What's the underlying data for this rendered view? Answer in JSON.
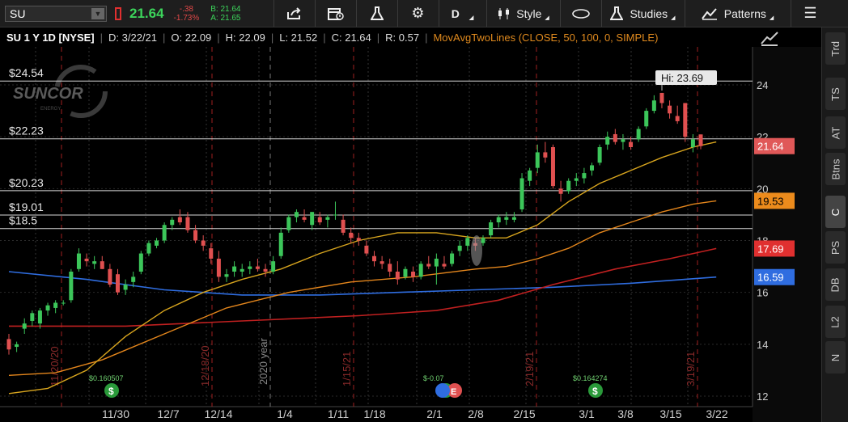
{
  "toolbar": {
    "symbol": "SU",
    "last": "21.64",
    "change": "-.38",
    "change_pct": "-1.73%",
    "bid": "B: 21.64",
    "ask": "A: 21.65",
    "period": "D",
    "style_label": "Style",
    "studies_label": "Studies",
    "patterns_label": "Patterns"
  },
  "header": {
    "title": "SU 1 Y 1D [NYSE]",
    "date": "D: 3/22/21",
    "open": "O: 22.09",
    "high": "H: 22.09",
    "low": "L: 21.52",
    "close": "C: 21.64",
    "range": "R: 0.57",
    "study": "MovAvgTwoLines (CLOSE, 50, 100, 0, SIMPLE)"
  },
  "sidebar_tabs": [
    "Trd",
    "TS",
    "AT",
    "Btns",
    "C",
    "PS",
    "DB",
    "L2",
    "N"
  ],
  "chart_data": {
    "type": "candlestick",
    "symbol": "SU",
    "price_axis": {
      "min": 12,
      "max": 25,
      "ticks": [
        12,
        14,
        16,
        18,
        20,
        22,
        24
      ]
    },
    "x_ticks": [
      "11/30",
      "12/7",
      "12/14",
      "1/4",
      "1/11",
      "1/18",
      "2/1",
      "2/8",
      "2/15",
      "3/1",
      "3/8",
      "3/15",
      "3/22"
    ],
    "levels": [
      {
        "label": "$24.54",
        "value": 24.15
      },
      {
        "label": "$22.23",
        "value": 21.92
      },
      {
        "label": "$20.23",
        "value": 19.92
      },
      {
        "label": "$19.01",
        "value": 18.98
      },
      {
        "label": "$18.5",
        "value": 18.46
      }
    ],
    "price_badges": [
      {
        "label": "21.64",
        "value": 21.64,
        "color": "#e05858"
      },
      {
        "label": "19.53",
        "value": 19.53,
        "color": "#ec8b1c"
      },
      {
        "label": "17.69",
        "value": 17.69,
        "color": "#e03030"
      },
      {
        "label": "16.59",
        "value": 16.59,
        "color": "#2f6de0"
      }
    ],
    "hi_label": "Hi: 23.69",
    "event_lines": [
      "11/20/20",
      "12/18/20",
      "2020 year",
      "1/15/21",
      "2/19/21",
      "3/19/21"
    ],
    "dividends": [
      {
        "label": "$0.160507"
      },
      {
        "label": "$-0.07"
      },
      {
        "label": "$0.164274"
      }
    ],
    "candles": [
      [
        14.2,
        14.4,
        13.6,
        13.8
      ],
      [
        13.9,
        14.1,
        13.7,
        14.0
      ],
      [
        14.6,
        15.0,
        14.4,
        14.8
      ],
      [
        14.9,
        15.3,
        14.7,
        15.2
      ],
      [
        14.8,
        15.4,
        14.6,
        15.3
      ],
      [
        15.3,
        15.6,
        15.1,
        15.5
      ],
      [
        15.4,
        15.7,
        15.2,
        15.6
      ],
      [
        15.6,
        15.7,
        15.5,
        15.6
      ],
      [
        15.7,
        16.9,
        15.6,
        16.8
      ],
      [
        16.9,
        17.7,
        16.8,
        17.5
      ],
      [
        17.3,
        17.5,
        17.0,
        17.2
      ],
      [
        17.1,
        17.4,
        16.9,
        17.2
      ],
      [
        17.2,
        17.4,
        16.9,
        16.9
      ],
      [
        16.9,
        17.1,
        16.2,
        16.3
      ],
      [
        16.7,
        16.9,
        15.9,
        16.0
      ],
      [
        16.1,
        16.5,
        15.9,
        16.3
      ],
      [
        16.4,
        16.8,
        16.2,
        16.6
      ],
      [
        16.8,
        17.6,
        16.7,
        17.5
      ],
      [
        17.5,
        18.0,
        17.4,
        17.9
      ],
      [
        17.8,
        18.1,
        17.7,
        18.0
      ],
      [
        18.0,
        18.7,
        17.9,
        18.6
      ],
      [
        18.6,
        18.9,
        18.4,
        18.8
      ],
      [
        18.9,
        19.2,
        18.6,
        18.7
      ],
      [
        18.9,
        19.1,
        18.3,
        18.4
      ],
      [
        18.4,
        18.6,
        17.9,
        18.0
      ],
      [
        18.0,
        18.2,
        17.6,
        17.8
      ],
      [
        17.7,
        17.9,
        17.1,
        17.3
      ],
      [
        17.3,
        17.6,
        16.4,
        16.6
      ],
      [
        16.6,
        16.9,
        16.4,
        16.7
      ],
      [
        16.8,
        17.2,
        16.6,
        17.0
      ],
      [
        16.8,
        17.1,
        16.6,
        16.9
      ],
      [
        16.9,
        17.2,
        16.7,
        17.0
      ],
      [
        17.0,
        17.3,
        16.8,
        16.9
      ],
      [
        16.9,
        17.1,
        16.6,
        16.8
      ],
      [
        16.8,
        17.4,
        16.7,
        17.2
      ],
      [
        17.4,
        18.5,
        17.3,
        18.3
      ],
      [
        18.4,
        19.0,
        18.3,
        18.9
      ],
      [
        18.9,
        19.2,
        18.7,
        19.1
      ],
      [
        18.9,
        19.2,
        18.7,
        18.8
      ],
      [
        18.6,
        19.1,
        18.4,
        19.1
      ],
      [
        18.9,
        19.1,
        18.6,
        18.7
      ],
      [
        18.8,
        19.0,
        18.5,
        18.9
      ],
      [
        19.0,
        19.5,
        18.8,
        19.0
      ],
      [
        18.8,
        19.0,
        18.2,
        18.3
      ],
      [
        18.3,
        18.5,
        17.9,
        18.1
      ],
      [
        18.1,
        18.3,
        17.8,
        18.0
      ],
      [
        17.8,
        18.0,
        17.4,
        17.5
      ],
      [
        17.4,
        17.6,
        17.0,
        17.2
      ],
      [
        17.2,
        17.4,
        16.9,
        17.1
      ],
      [
        17.1,
        17.3,
        16.6,
        16.8
      ],
      [
        16.8,
        17.2,
        16.3,
        16.5
      ],
      [
        16.6,
        17.0,
        16.5,
        16.9
      ],
      [
        16.8,
        17.0,
        16.4,
        16.6
      ],
      [
        16.6,
        17.2,
        16.5,
        17.1
      ],
      [
        17.1,
        17.4,
        16.9,
        17.0
      ],
      [
        17.0,
        17.5,
        16.3,
        17.3
      ],
      [
        17.1,
        17.4,
        16.9,
        17.0
      ],
      [
        17.1,
        17.6,
        17.0,
        17.5
      ],
      [
        17.6,
        18.0,
        17.4,
        17.8
      ],
      [
        17.8,
        18.2,
        17.6,
        18.1
      ],
      [
        17.9,
        18.1,
        17.6,
        17.8
      ],
      [
        17.9,
        18.2,
        17.8,
        18.1
      ],
      [
        18.2,
        18.8,
        18.1,
        18.7
      ],
      [
        18.7,
        19.0,
        18.5,
        18.9
      ],
      [
        18.8,
        19.1,
        18.6,
        18.9
      ],
      [
        18.8,
        19.1,
        18.7,
        18.9
      ],
      [
        19.2,
        20.6,
        19.1,
        20.4
      ],
      [
        20.3,
        20.8,
        20.1,
        20.7
      ],
      [
        20.8,
        21.7,
        20.6,
        21.4
      ],
      [
        21.4,
        21.8,
        21.0,
        21.2
      ],
      [
        21.6,
        21.7,
        20.0,
        20.1
      ],
      [
        20.0,
        20.3,
        19.5,
        19.8
      ],
      [
        19.9,
        20.4,
        19.8,
        20.3
      ],
      [
        20.3,
        20.6,
        20.1,
        20.4
      ],
      [
        20.4,
        20.8,
        20.2,
        20.6
      ],
      [
        20.7,
        21.0,
        20.5,
        20.9
      ],
      [
        21.0,
        21.7,
        20.9,
        21.6
      ],
      [
        21.7,
        22.2,
        21.5,
        22.0
      ],
      [
        22.1,
        22.3,
        21.7,
        21.8
      ],
      [
        21.8,
        22.1,
        21.5,
        21.9
      ],
      [
        21.8,
        22.0,
        21.5,
        21.6
      ],
      [
        21.9,
        22.4,
        21.8,
        22.3
      ],
      [
        22.4,
        23.1,
        22.3,
        23.0
      ],
      [
        23.0,
        23.6,
        22.9,
        23.4
      ],
      [
        23.69,
        23.69,
        23.1,
        23.3
      ],
      [
        23.2,
        23.4,
        22.7,
        22.9
      ],
      [
        22.8,
        23.2,
        22.5,
        22.6
      ],
      [
        23.3,
        23.3,
        21.8,
        22.0
      ],
      [
        21.6,
        22.1,
        21.4,
        21.9
      ],
      [
        22.09,
        22.09,
        21.52,
        21.64
      ]
    ],
    "sma_50": [
      [
        0,
        12.8
      ],
      [
        6,
        12.9
      ],
      [
        12,
        13.4
      ],
      [
        20,
        14.4
      ],
      [
        28,
        15.4
      ],
      [
        36,
        16.0
      ],
      [
        44,
        16.4
      ],
      [
        52,
        16.6
      ],
      [
        60,
        16.9
      ],
      [
        64,
        17.0
      ],
      [
        68,
        17.3
      ],
      [
        72,
        17.7
      ],
      [
        76,
        18.3
      ],
      [
        80,
        18.7
      ],
      [
        84,
        19.1
      ],
      [
        88,
        19.4
      ],
      [
        91,
        19.53
      ]
    ],
    "sma_100": [
      [
        0,
        16.8
      ],
      [
        10,
        16.5
      ],
      [
        20,
        16.1
      ],
      [
        30,
        15.9
      ],
      [
        40,
        15.9
      ],
      [
        50,
        16.0
      ],
      [
        60,
        16.1
      ],
      [
        70,
        16.2
      ],
      [
        80,
        16.35
      ],
      [
        91,
        16.59
      ]
    ],
    "sma_red": [
      [
        0,
        14.7
      ],
      [
        15,
        14.7
      ],
      [
        30,
        14.9
      ],
      [
        45,
        15.1
      ],
      [
        55,
        15.3
      ],
      [
        63,
        15.7
      ],
      [
        70,
        16.3
      ],
      [
        78,
        16.9
      ],
      [
        85,
        17.3
      ],
      [
        91,
        17.69
      ]
    ],
    "sma_gold": [
      [
        0,
        12.1
      ],
      [
        5,
        12.3
      ],
      [
        10,
        13.0
      ],
      [
        15,
        14.3
      ],
      [
        20,
        15.3
      ],
      [
        25,
        16.0
      ],
      [
        30,
        16.5
      ],
      [
        35,
        16.9
      ],
      [
        40,
        17.5
      ],
      [
        45,
        18.0
      ],
      [
        50,
        18.3
      ],
      [
        55,
        18.3
      ],
      [
        60,
        18.1
      ],
      [
        64,
        18.1
      ],
      [
        68,
        18.6
      ],
      [
        72,
        19.5
      ],
      [
        76,
        20.2
      ],
      [
        80,
        20.7
      ],
      [
        84,
        21.2
      ],
      [
        88,
        21.6
      ],
      [
        91,
        21.8
      ]
    ],
    "colors": {
      "up": "#3cc65a",
      "down": "#e05050",
      "sma_50": "#d8a51e",
      "sma_100": "#2f6de0",
      "sma_red": "#c02020",
      "sma_orange": "#e4861c"
    }
  }
}
